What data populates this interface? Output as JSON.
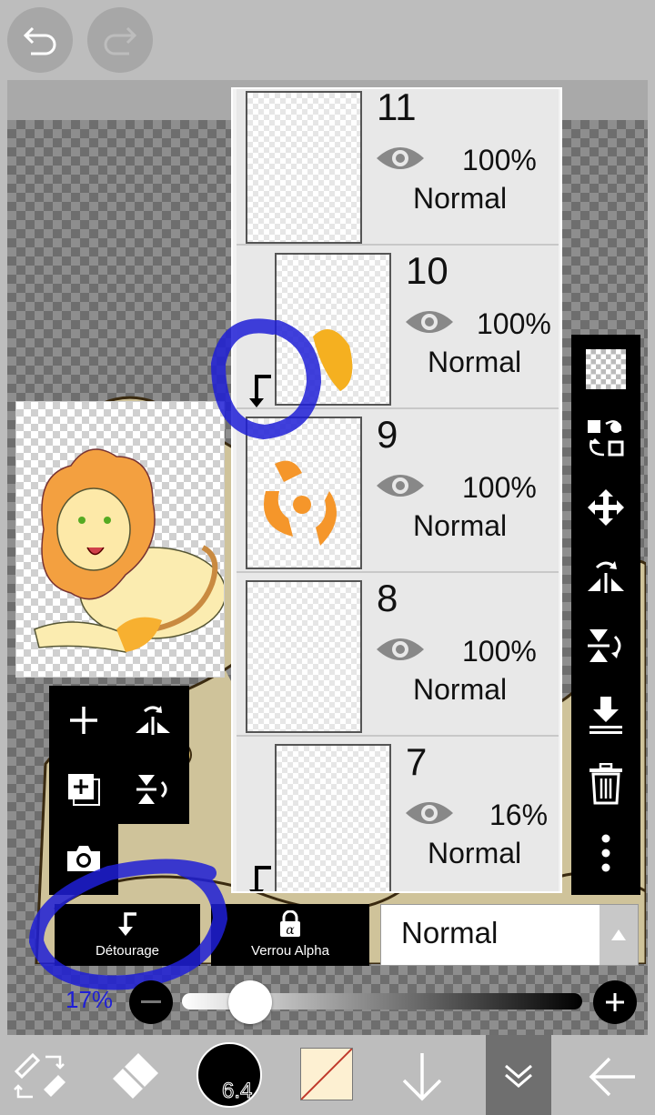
{
  "toolbar_top": {
    "undo_icon": "undo-arrow-icon",
    "redo_icon": "redo-arrow-icon"
  },
  "layers": [
    {
      "number": "11",
      "opacity": "100%",
      "mode": "Normal",
      "clipped": false
    },
    {
      "number": "10",
      "opacity": "100%",
      "mode": "Normal",
      "clipped": true
    },
    {
      "number": "9",
      "opacity": "100%",
      "mode": "Normal",
      "clipped": false
    },
    {
      "number": "8",
      "opacity": "100%",
      "mode": "Normal",
      "clipped": false
    },
    {
      "number": "7",
      "opacity": "16%",
      "mode": "Normal",
      "clipped": true
    }
  ],
  "bottom_controls": {
    "clipping_label": "Détourage",
    "alpha_lock_label": "Verrou Alpha",
    "blend_mode": "Normal",
    "opacity_value": "17%",
    "opacity_level": 0.17
  },
  "bottom_bar": {
    "brush_size": "6.4"
  },
  "colors": {
    "accent_blue": "#1f1fd6",
    "panel_bg": "#e8e8e8",
    "toolbar_bg": "#000000"
  }
}
